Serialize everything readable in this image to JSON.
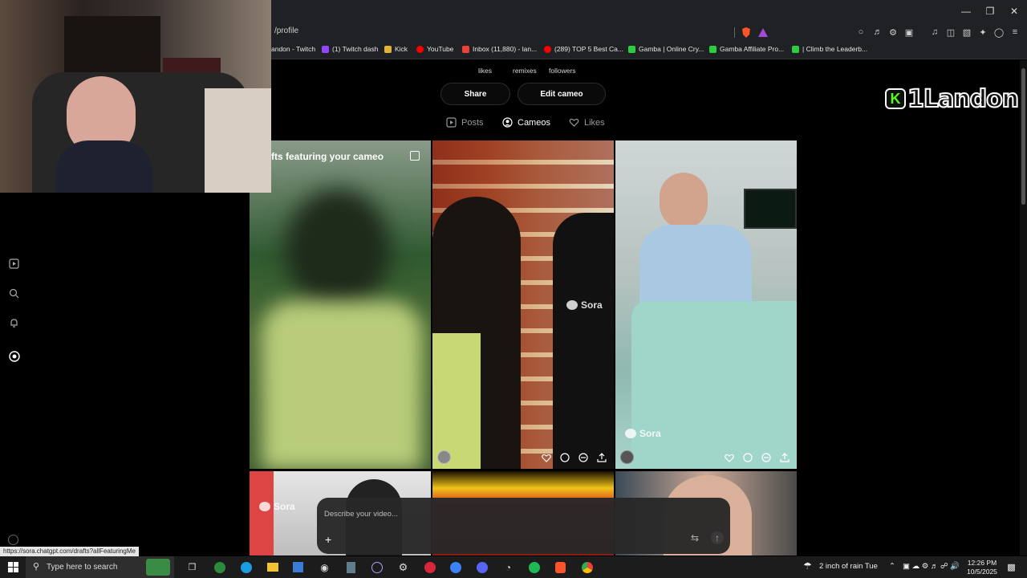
{
  "browser": {
    "url": "/profile",
    "bookmarks": [
      {
        "label": "andon - Twitch",
        "color": "#9146ff"
      },
      {
        "label": "(1) Twitch dash",
        "color": "#9146ff"
      },
      {
        "label": "Kick",
        "color": "#e0b23a"
      },
      {
        "label": "YouTube",
        "color": "#ff0000"
      },
      {
        "label": "Inbox (11,880) - lan...",
        "color": "#ea4335"
      },
      {
        "label": "(289) TOP 5 Best Ca...",
        "color": "#ff0000"
      },
      {
        "label": "Gamba | Online Cry...",
        "color": "#2ecc40"
      },
      {
        "label": "Gamba Affiliate Pro...",
        "color": "#2ecc40"
      },
      {
        "label": "| Climb the Leaderb...",
        "color": "#2ecc40"
      }
    ]
  },
  "profile": {
    "stats": [
      "likes",
      "remixes",
      "followers"
    ],
    "share_label": "Share",
    "edit_label": "Edit cameo",
    "tabs": [
      {
        "label": "Posts",
        "icon": "play-square-icon"
      },
      {
        "label": "Cameos",
        "icon": "cameo-icon"
      },
      {
        "label": "Likes",
        "icon": "heart-icon"
      }
    ],
    "active_tab": "Cameos"
  },
  "grid": {
    "drafts_title": "fts featuring your cameo",
    "sora_watermark": "Sora"
  },
  "composer": {
    "placeholder": "Describe your video..."
  },
  "overlay": {
    "logo_text": "1Landon",
    "logo_letter": "K"
  },
  "status_url": "https://sora.chatgpt.com/drafts?allFeaturingMe",
  "taskbar": {
    "search_placeholder": "Type here to search",
    "weather": "2 inch of rain Tue",
    "time": "12:26 PM",
    "date": "10/5/2025"
  },
  "colors": {
    "accent_twitch": "#9146ff",
    "kick_green": "#53fc18",
    "background": "#000000"
  }
}
